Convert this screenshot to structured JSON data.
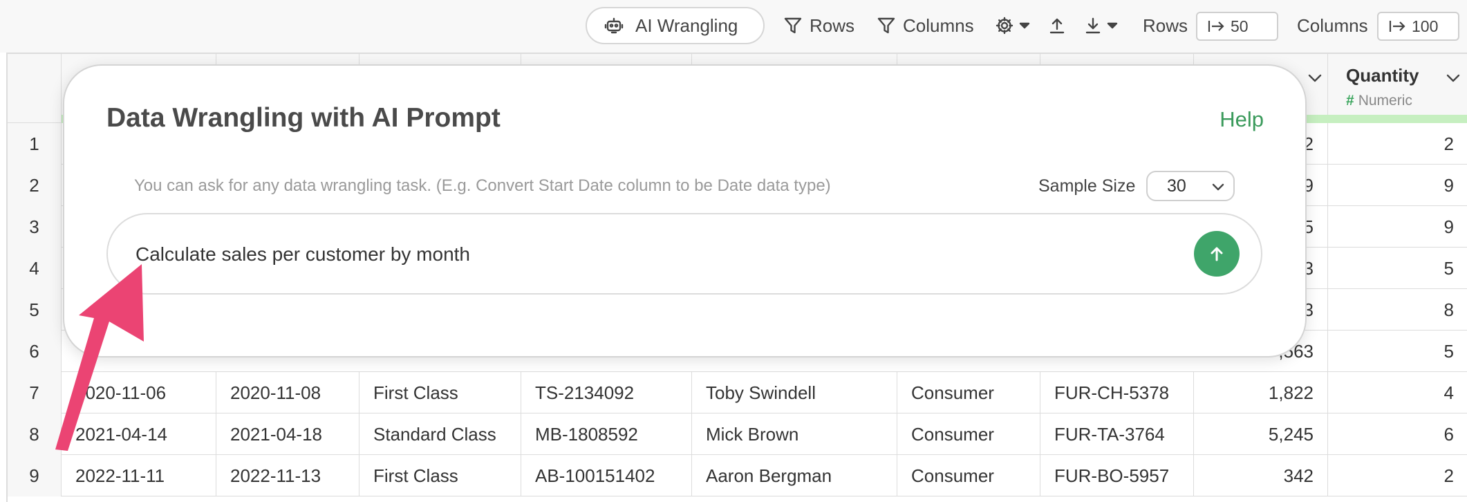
{
  "toolbar": {
    "ai_wrangling_label": "AI Wrangling",
    "rows_filter_label": "Rows",
    "columns_filter_label": "Columns",
    "rows_label": "Rows",
    "rows_value": "50",
    "columns_label": "Columns",
    "columns_value": "100"
  },
  "grid": {
    "visible_header": {
      "title": "Quantity",
      "type": "Numeric"
    },
    "row_numbers": [
      "1",
      "2",
      "3",
      "4",
      "5",
      "6",
      "7",
      "8",
      "9"
    ],
    "sales_partial": [
      "2",
      "9",
      "5",
      "3",
      "3",
      ",563"
    ],
    "quantity": [
      "2",
      "9",
      "9",
      "5",
      "8",
      "5",
      "4",
      "6",
      "2"
    ],
    "rows": [
      {
        "order_date": "2020-11-06",
        "ship_date": "2020-11-08",
        "ship_mode": "First Class",
        "customer_id": "TS-2134092",
        "customer_name": "Toby Swindell",
        "segment": "Consumer",
        "product_id": "FUR-CH-5378",
        "sales": "1,822"
      },
      {
        "order_date": "2021-04-14",
        "ship_date": "2021-04-18",
        "ship_mode": "Standard Class",
        "customer_id": "MB-1808592",
        "customer_name": "Mick Brown",
        "segment": "Consumer",
        "product_id": "FUR-TA-3764",
        "sales": "5,245"
      },
      {
        "order_date": "2022-11-11",
        "ship_date": "2022-11-13",
        "ship_mode": "First Class",
        "customer_id": "AB-100151402",
        "customer_name": "Aaron Bergman",
        "segment": "Consumer",
        "product_id": "FUR-BO-5957",
        "sales": "342"
      }
    ]
  },
  "dialog": {
    "title": "Data Wrangling with AI Prompt",
    "help": "Help",
    "hint": "You can ask for any data wrangling task. (E.g. Convert Start Date column to be Date data type)",
    "sample_size_label": "Sample Size",
    "sample_size_value": "30",
    "prompt_value": "Calculate sales per customer by month"
  },
  "colors": {
    "accent_green": "#3fa56a",
    "header_green_bar": "#c6efc0",
    "annotation_arrow": "#eb4473"
  },
  "icons": [
    "robot-icon",
    "filter-icon",
    "gear-icon",
    "upload-icon",
    "download-icon",
    "arrow-to-line-icon",
    "chevron-down-icon",
    "send-arrow-icon"
  ]
}
